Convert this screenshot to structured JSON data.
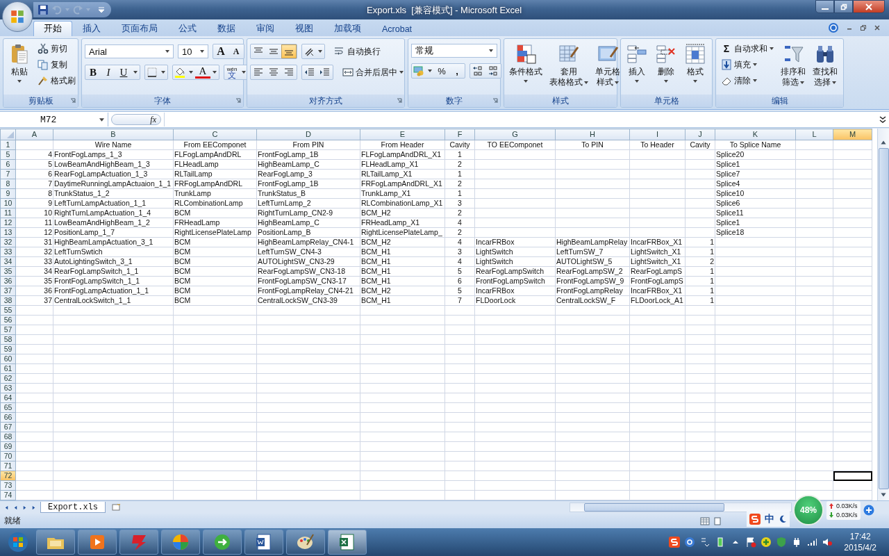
{
  "window": {
    "title": "Export.xls  [兼容模式] - Microsoft Excel"
  },
  "tabs": [
    {
      "label": "开始",
      "selected": true
    },
    {
      "label": "插入",
      "selected": false
    },
    {
      "label": "页面布局",
      "selected": false
    },
    {
      "label": "公式",
      "selected": false
    },
    {
      "label": "数据",
      "selected": false
    },
    {
      "label": "审阅",
      "selected": false
    },
    {
      "label": "视图",
      "selected": false
    },
    {
      "label": "加载项",
      "selected": false
    },
    {
      "label": "Acrobat",
      "selected": false
    }
  ],
  "ribbon": {
    "clipboard": {
      "label": "剪贴板",
      "paste": "粘贴",
      "cut": "剪切",
      "copy": "复制",
      "format_painter": "格式刷"
    },
    "font": {
      "label": "字体",
      "font_name": "Arial",
      "font_size": "10",
      "grow": "A",
      "shrink": "A",
      "bold": "B",
      "italic": "I",
      "underline": "U",
      "font_color": "A",
      "phonetic_pinyin": "wén",
      "phonetic_char": "文"
    },
    "alignment": {
      "label": "对齐方式",
      "vertical": [
        {
          "selected": false
        },
        {
          "selected": false
        },
        {
          "selected": true
        }
      ],
      "wrap_text": "自动换行",
      "merge_center": "合并后居中"
    },
    "number": {
      "label": "数字",
      "format": "常规",
      "percent": "%",
      "comma": ","
    },
    "styles": {
      "label": "样式",
      "buttons": [
        {
          "lines": [
            "条件格式"
          ]
        },
        {
          "lines": [
            "套用",
            "表格格式"
          ]
        },
        {
          "lines": [
            "单元格",
            "样式"
          ]
        }
      ]
    },
    "cells": {
      "label": "单元格",
      "buttons": [
        {
          "lines": [
            "插入"
          ]
        },
        {
          "lines": [
            "删除"
          ]
        },
        {
          "lines": [
            "格式"
          ]
        }
      ]
    },
    "editing": {
      "label": "编辑",
      "sigma": "Σ",
      "autosum": "自动求和",
      "fill": "填充",
      "clear": "清除",
      "buttons": [
        {
          "lines": [
            "排序和",
            "筛选"
          ]
        },
        {
          "lines": [
            "查找和",
            "选择"
          ]
        }
      ]
    }
  },
  "formula_bar": {
    "name_box": "M72",
    "fx": "fx"
  },
  "sheet": {
    "columns": [
      {
        "letter": "A",
        "kind": "number",
        "selected": false
      },
      {
        "letter": "B",
        "kind": "text",
        "selected": false
      },
      {
        "letter": "C",
        "kind": "text",
        "selected": false
      },
      {
        "letter": "D",
        "kind": "text",
        "selected": false
      },
      {
        "letter": "E",
        "kind": "text",
        "selected": false
      },
      {
        "letter": "F",
        "kind": "center",
        "selected": false
      },
      {
        "letter": "G",
        "kind": "text",
        "selected": false
      },
      {
        "letter": "H",
        "kind": "text",
        "selected": false
      },
      {
        "letter": "I",
        "kind": "text",
        "selected": false
      },
      {
        "letter": "J",
        "kind": "number",
        "selected": false
      },
      {
        "letter": "K",
        "kind": "text",
        "selected": false
      },
      {
        "letter": "L",
        "selected": false
      },
      {
        "letter": "M",
        "selected": true
      }
    ],
    "rows": [
      {
        "num": "1",
        "kind": "header",
        "selected": false,
        "cells": {
          "B": "Wire Name",
          "C": "From EEComponet",
          "D": "From PIN",
          "E": "From Header",
          "F": "Cavity",
          "G": "TO EEComponet",
          "H": "To PIN",
          "I": "To Header",
          "J": "Cavity",
          "K": "To Splice Name"
        }
      },
      {
        "num": "5",
        "kind": "data",
        "selected": false,
        "cells": {
          "A": "4",
          "B": "FrontFogLamps_1_3",
          "C": "FLFogLampAndDRL",
          "D": "FrontFogLamp_1B",
          "E": "FLFogLampAndDRL_X1",
          "F": "1",
          "K": "Splice20"
        }
      },
      {
        "num": "6",
        "kind": "data",
        "selected": false,
        "cells": {
          "A": "5",
          "B": "LowBeamAndHighBeam_1_3",
          "C": "FLHeadLamp",
          "D": "HighBeamLamp_C",
          "E": "FLHeadLamp_X1",
          "F": "2",
          "K": "Splice1"
        }
      },
      {
        "num": "7",
        "kind": "data",
        "selected": false,
        "cells": {
          "A": "6",
          "B": "RearFogLampActuation_1_3",
          "C": "RLTailLamp",
          "D": "RearFogLamp_3",
          "E": "RLTailLamp_X1",
          "F": "1",
          "K": "Splice7"
        }
      },
      {
        "num": "8",
        "kind": "data",
        "selected": false,
        "cells": {
          "A": "7",
          "B": "DaytimeRunningLampActuaion_1_1",
          "C": "FRFogLampAndDRL",
          "D": "FrontFogLamp_1B",
          "E": "FRFogLampAndDRL_X1",
          "F": "2",
          "K": "Splice4"
        }
      },
      {
        "num": "9",
        "kind": "data",
        "selected": false,
        "cells": {
          "A": "8",
          "B": "TrunkStatus_1_2",
          "C": "TrunkLamp",
          "D": "TrunkStatus_B",
          "E": "TrunkLamp_X1",
          "F": "1",
          "K": "Splice10"
        }
      },
      {
        "num": "10",
        "kind": "data",
        "selected": false,
        "cells": {
          "A": "9",
          "B": "LeftTurnLampActuation_1_1",
          "C": "RLCombinationLamp",
          "D": "LeftTurnLamp_2",
          "E": "RLCombinationLamp_X1",
          "F": "3",
          "K": "Splice6"
        }
      },
      {
        "num": "11",
        "kind": "data",
        "selected": false,
        "cells": {
          "A": "10",
          "B": "RightTurnLampActuation_1_4",
          "C": "BCM",
          "D": "RightTurnLamp_CN2-9",
          "E": "BCM_H2",
          "F": "2",
          "K": "Splice11"
        }
      },
      {
        "num": "12",
        "kind": "data",
        "selected": false,
        "cells": {
          "A": "11",
          "B": "LowBeamAndHighBeam_1_2",
          "C": "FRHeadLamp",
          "D": "HighBeamLamp_C",
          "E": "FRHeadLamp_X1",
          "F": "4",
          "K": "Splice1"
        }
      },
      {
        "num": "13",
        "kind": "data",
        "selected": false,
        "cells": {
          "A": "12",
          "B": "PositionLamp_1_7",
          "C": "RightLicensePlateLamp",
          "D": "PositionLamp_B",
          "E": "RightLicensePlateLamp_",
          "F": "2",
          "K": "Splice18"
        }
      },
      {
        "num": "32",
        "kind": "data",
        "selected": false,
        "cells": {
          "A": "31",
          "B": "HighBeamLampActuation_3_1",
          "C": "BCM",
          "D": "HighBeamLampRelay_CN4-1",
          "E": "BCM_H2",
          "F": "4",
          "G": "IncarFRBox",
          "H": "HighBeamLampRelay",
          "I": "IncarFRBox_X1",
          "J": "1"
        }
      },
      {
        "num": "33",
        "kind": "data",
        "selected": false,
        "cells": {
          "A": "32",
          "B": "LeftTurnSwtich",
          "C": "BCM",
          "D": "LeftTurnSW_CN4-3",
          "E": "BCM_H1",
          "F": "3",
          "G": "LightSwitch",
          "H": "LeftTurnSW_7",
          "I": "LightSwitch_X1",
          "J": "1"
        }
      },
      {
        "num": "34",
        "kind": "data",
        "selected": false,
        "cells": {
          "A": "33",
          "B": "AutoLightingSwitch_3_1",
          "C": "BCM",
          "D": "AUTOLightSW_CN3-29",
          "E": "BCM_H1",
          "F": "4",
          "G": "LightSwitch",
          "H": "AUTOLightSW_5",
          "I": "LightSwitch_X1",
          "J": "2"
        }
      },
      {
        "num": "35",
        "kind": "data",
        "selected": false,
        "cells": {
          "A": "34",
          "B": "RearFogLampSwitch_1_1",
          "C": "BCM",
          "D": "RearFogLampSW_CN3-18",
          "E": "BCM_H1",
          "F": "5",
          "G": "RearFogLampSwitch",
          "H": "RearFogLampSW_2",
          "I": "RearFogLampS",
          "J": "1"
        }
      },
      {
        "num": "36",
        "kind": "data",
        "selected": false,
        "cells": {
          "A": "35",
          "B": "FrontFogLampSwitch_1_1",
          "C": "BCM",
          "D": "FrontFogLampSW_CN3-17",
          "E": "BCM_H1",
          "F": "6",
          "G": "FrontFogLampSwitch",
          "H": "FrontFogLampSW_9",
          "I": "FrontFogLampS",
          "J": "1"
        }
      },
      {
        "num": "37",
        "kind": "data",
        "selected": false,
        "cells": {
          "A": "36",
          "B": "FrontFogLampActuation_1_1",
          "C": "BCM",
          "D": "FrontFogLampRelay_CN4-21",
          "E": "BCM_H2",
          "F": "5",
          "G": "IncarFRBox",
          "H": "FrontFogLampRelay",
          "I": "IncarFRBox_X1",
          "J": "1"
        }
      },
      {
        "num": "38",
        "kind": "data",
        "selected": false,
        "cells": {
          "A": "37",
          "B": "CentralLockSwitch_1_1",
          "C": "BCM",
          "D": "CentralLockSW_CN3-39",
          "E": "BCM_H1",
          "F": "7",
          "G": "FLDoorLock",
          "H": "CentralLockSW_F",
          "I": "FLDoorLock_A1",
          "J": "1"
        }
      },
      {
        "num": "55",
        "selected": false
      },
      {
        "num": "56",
        "selected": false
      },
      {
        "num": "57",
        "selected": false
      },
      {
        "num": "58",
        "selected": false
      },
      {
        "num": "59",
        "selected": false
      },
      {
        "num": "60",
        "selected": false
      },
      {
        "num": "61",
        "selected": false
      },
      {
        "num": "62",
        "selected": false
      },
      {
        "num": "63",
        "selected": false
      },
      {
        "num": "64",
        "selected": false
      },
      {
        "num": "65",
        "selected": false
      },
      {
        "num": "66",
        "selected": false
      },
      {
        "num": "67",
        "selected": false
      },
      {
        "num": "68",
        "selected": false
      },
      {
        "num": "69",
        "selected": false
      },
      {
        "num": "70",
        "selected": false
      },
      {
        "num": "71",
        "selected": false
      },
      {
        "num": "72",
        "selected": true
      },
      {
        "num": "73",
        "selected": false
      },
      {
        "num": "74",
        "selected": false
      }
    ]
  },
  "sheet_tabs": [
    {
      "label": "Export.xls",
      "selected": true
    }
  ],
  "status_bar": {
    "text": "就绪"
  },
  "ime": {
    "label": "中"
  },
  "net_monitor": {
    "percent": "48%",
    "upload": "0.03K/s",
    "download": "0.03K/s"
  },
  "clock": {
    "time": "17:42",
    "date": "2015/4/2"
  }
}
